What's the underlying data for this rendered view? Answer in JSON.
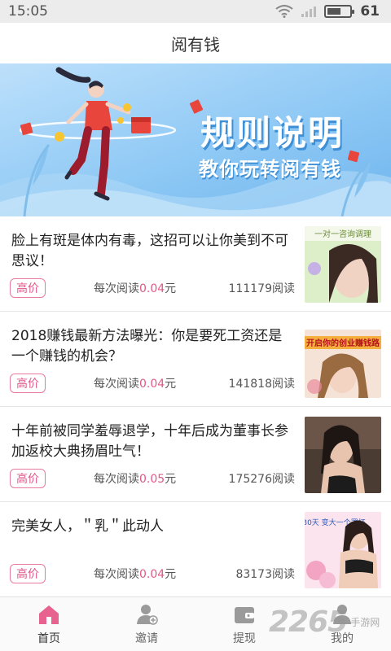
{
  "status_bar": {
    "time": "15:05",
    "battery": "61",
    "battery_fraction": 0.61
  },
  "header": {
    "title": "阅有钱"
  },
  "banner": {
    "title": "规则说明",
    "subtitle": "教你玩转阅有钱"
  },
  "articles": [
    {
      "title": "脸上有斑是体内有毒，这招可以让你美到不可思议！",
      "tag": "高价",
      "rate_prefix": "每次阅读",
      "rate_value": "0.04",
      "rate_suffix": "元",
      "reads": "111179阅读",
      "thumb_caption": "一对一咨询调理"
    },
    {
      "title": "2018赚钱最新方法曝光：你是要死工资还是一个赚钱的机会？",
      "tag": "高价",
      "rate_prefix": "每次阅读",
      "rate_value": "0.04",
      "rate_suffix": "元",
      "reads": "141818阅读",
      "thumb_caption": "开启你的创业赚钱路"
    },
    {
      "title": "十年前被同学羞辱退学，十年后成为董事长参加返校大典扬眉吐气！",
      "tag": "高价",
      "rate_prefix": "每次阅读",
      "rate_value": "0.05",
      "rate_suffix": "元",
      "reads": "175276阅读",
      "thumb_caption": ""
    },
    {
      "title": "完美女人，＂乳＂此动人",
      "tag": "高价",
      "rate_prefix": "每次阅读",
      "rate_value": "0.04",
      "rate_suffix": "元",
      "reads": "83173阅读",
      "thumb_caption": "30天 变大一个罩杯"
    }
  ],
  "bottom_nav": [
    {
      "label": "首页",
      "icon": "home-icon",
      "active": true
    },
    {
      "label": "邀请",
      "icon": "invite-icon",
      "active": false
    },
    {
      "label": "提现",
      "icon": "wallet-icon",
      "active": false
    },
    {
      "label": "我的",
      "icon": "profile-icon",
      "active": false
    }
  ],
  "watermark": {
    "number": "2265",
    "text": "手游网"
  },
  "colors": {
    "accent": "#e05788",
    "banner_blue": "#8fc9f5",
    "nav_active": "#e8628f"
  }
}
